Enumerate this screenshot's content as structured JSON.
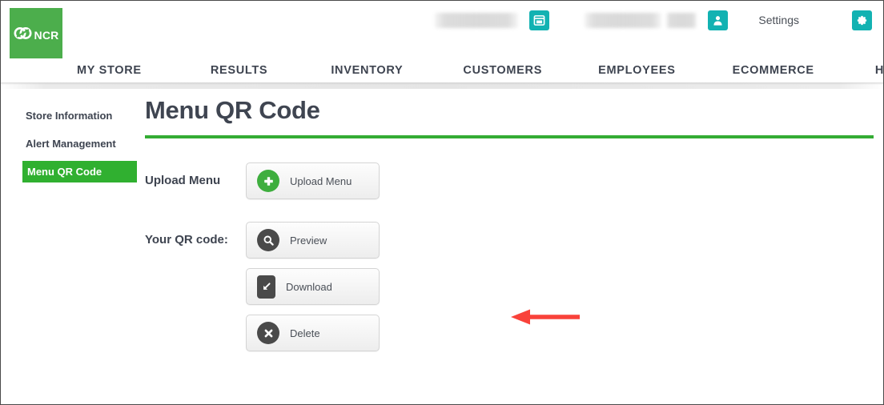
{
  "brand": {
    "logo_text": "NCR",
    "logo_icon": "ncr-interlocking-rings-icon",
    "green": "#4cae4c"
  },
  "topbar": {
    "store_field_value": "",
    "store_icon": "store-icon",
    "user_field_value": "",
    "user_icon": "user-account-icon",
    "settings_label": "Settings",
    "settings_gear_icon": "gear-icon",
    "teal": "#12b2b2"
  },
  "nav": {
    "items": [
      {
        "label": "MY STORE"
      },
      {
        "label": "RESULTS"
      },
      {
        "label": "INVENTORY"
      },
      {
        "label": "CUSTOMERS"
      },
      {
        "label": "EMPLOYEES"
      },
      {
        "label": "ECOMMERCE"
      },
      {
        "label": "HELP"
      }
    ]
  },
  "sidebar": {
    "items": [
      {
        "label": "Store Information",
        "active": false
      },
      {
        "label": "Alert Management",
        "active": false
      },
      {
        "label": "Menu QR Code",
        "active": true
      }
    ],
    "active_bg": "#30b030"
  },
  "main": {
    "title": "Menu QR Code",
    "rule_color": "#34ac34",
    "upload_row": {
      "label": "Upload Menu",
      "button": {
        "label": "Upload Menu",
        "icon": "plus-circle-icon",
        "icon_color": "#3eae3e"
      }
    },
    "qr_row": {
      "label": "Your QR code:",
      "buttons": [
        {
          "label": "Preview",
          "icon": "magnifier-circle-icon",
          "icon_color": "#4a4a4a"
        },
        {
          "label": "Download",
          "icon": "download-arrow-icon",
          "icon_color": "#4a4a4a"
        },
        {
          "label": "Delete",
          "icon": "x-circle-icon",
          "icon_color": "#4a4a4a"
        }
      ]
    }
  },
  "annotation": {
    "arrow": {
      "name": "red-left-arrow",
      "color": "#f9423a",
      "direction": "left",
      "points_to": "Preview"
    }
  }
}
